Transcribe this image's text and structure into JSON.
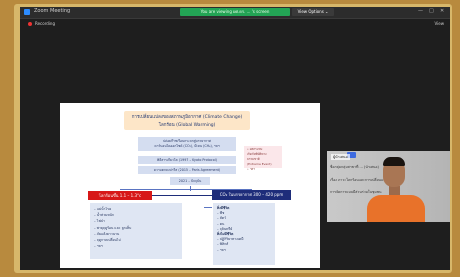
{
  "window": {
    "app_title": "Zoom Meeting",
    "share_banner": "You are viewing ผศ.ดร. ... 's screen",
    "view_options": "View Options ⌄",
    "controls": [
      "—",
      "□",
      "✕"
    ],
    "recording_label": "Recording",
    "view_label": "View"
  },
  "slide": {
    "title_line1": "การเปลี่ยนแปลงของสภาพภูมิอากาศ (Climate Change)",
    "title_line2": "โลกร้อน (Global Warming)",
    "box1_line1": "ปล่อยก๊าซเรือนกระจกสู่บรรยากาศ",
    "box1_line2": "คาร์บอนไดออกไซด์ (CO₂), มีเทน (CH₄), ฯลฯ",
    "box2": "พิธีสารเกียวโต (1997 – Kyoto Protocol)",
    "box3": "ความตกลงปารีส (2015 – Paris Agreement)",
    "box4": "2021 – ปัจจุบัน",
    "pink_lines": [
      "• ผลกระทบ",
      "เกิดภัยพิบัติทางธรรมชาติ",
      "(Extreme Event)",
      "• ฯลฯ"
    ],
    "red_head": "โลกร้อนขึ้น 1.1 – 1.3°c",
    "navy_head": "CO₂ ในบรรยากาศ 300 – 420 ppm",
    "left_items": [
      "– แม่น้ำโขง",
      "– น้ำท่วมหนัก",
      "– ไฟป่า",
      "– พายุฤดูร้อน และ ลูกเห็บ",
      "– ภัยแล้งยาวนาน",
      "– ฤดูกาลเปลี่ยนไป",
      "– ฯลฯ"
    ],
    "right_head1": "สิ่งมีชีวิต",
    "right_items1": [
      "– พืช",
      "– สัตว์",
      "– คน",
      "– จุลินทรีย์"
    ],
    "right_head2": "สิ่งไม่มีชีวิต",
    "right_items2": [
      "– ปฏิกิริยาทางเคมี",
      "– พิสิกส์",
      "– ฯลฯ"
    ]
  },
  "presenter": {
    "name_tag": "ผู้นำเสนอ",
    "line1": "ชื่อกลุ่มกลุ่มสาขาที่ ... (นำเสนอ)",
    "line2": "เรื่อง ภาวะโลกร้อนและการเปลี่ยนแปลง",
    "line3": "การจัดการแบบมีส่วนร่วมในชุมชน"
  }
}
